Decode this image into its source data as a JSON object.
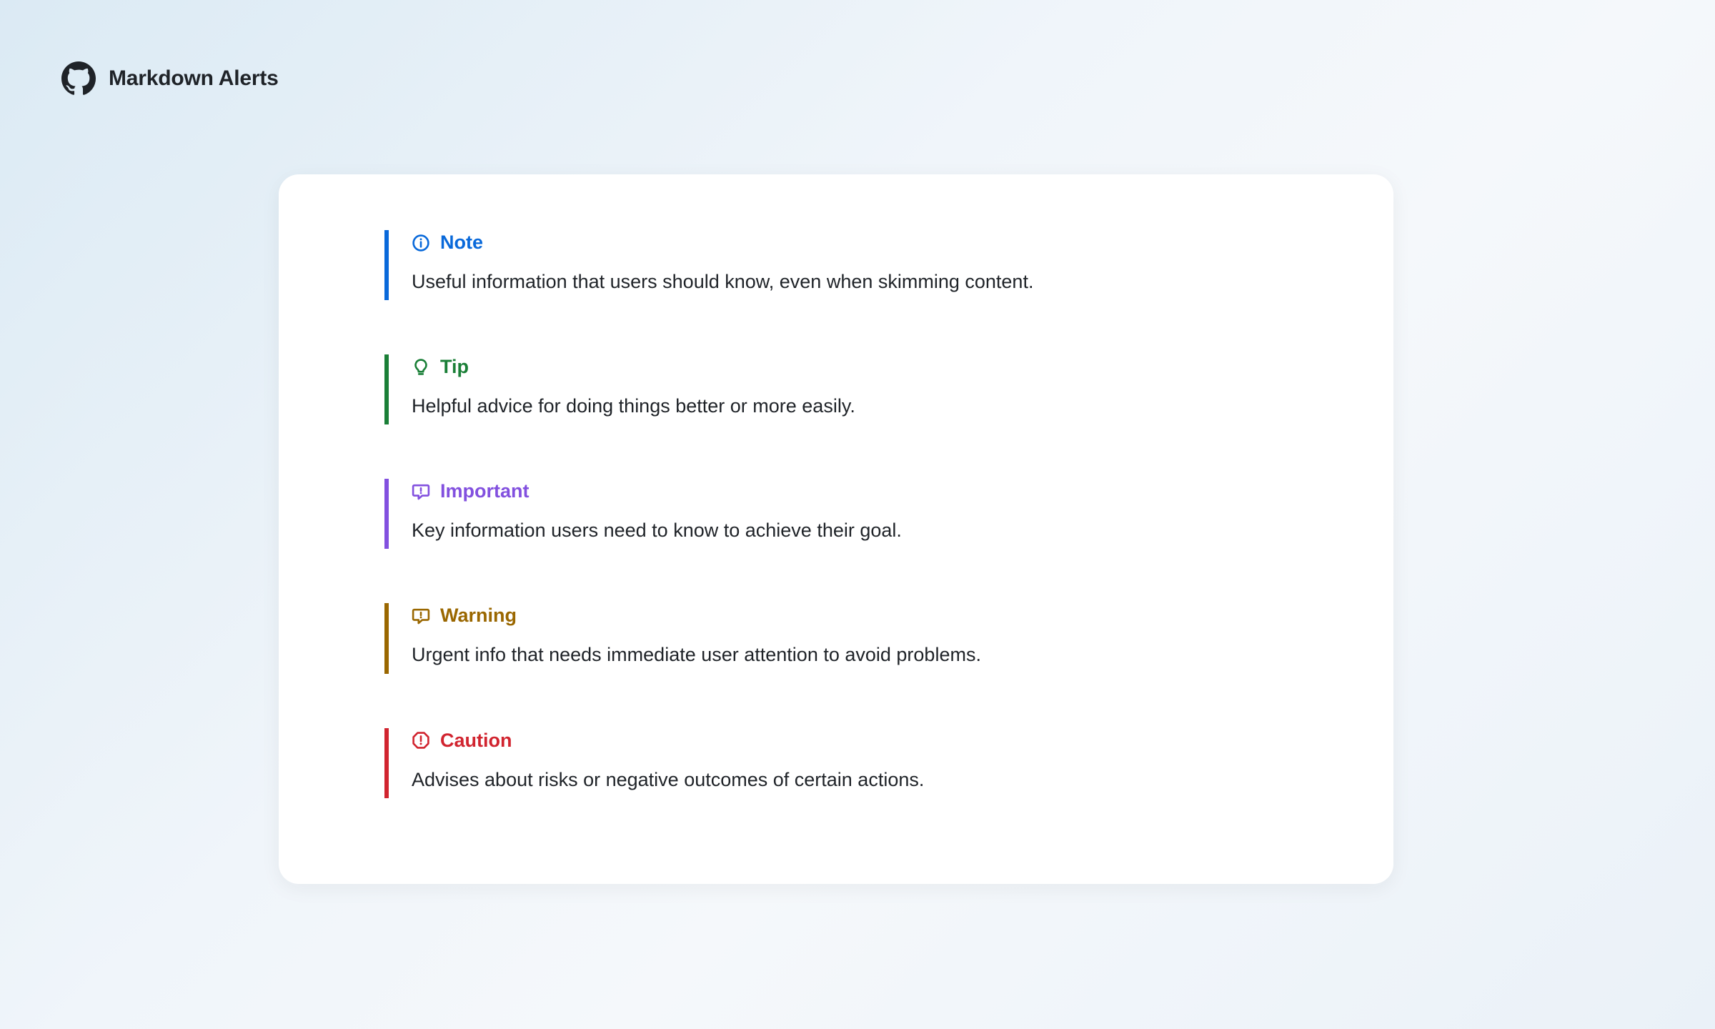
{
  "header": {
    "title": "Markdown Alerts"
  },
  "colors": {
    "note": "#0969da",
    "tip": "#1a7f37",
    "important": "#8250df",
    "warning": "#9a6700",
    "caution": "#d1242f"
  },
  "alerts": [
    {
      "key": "note",
      "icon": "info-icon",
      "title": "Note",
      "body": "Useful information that users should know, even when skimming content."
    },
    {
      "key": "tip",
      "icon": "lightbulb-icon",
      "title": "Tip",
      "body": "Helpful advice for doing things better or more easily."
    },
    {
      "key": "important",
      "icon": "comment-alert-icon",
      "title": "Important",
      "body": "Key information users need to know to achieve their goal."
    },
    {
      "key": "warning",
      "icon": "comment-alert-icon",
      "title": "Warning",
      "body": "Urgent info that needs immediate user attention to avoid problems."
    },
    {
      "key": "caution",
      "icon": "stop-icon",
      "title": "Caution",
      "body": "Advises about risks or negative outcomes of certain actions."
    }
  ]
}
